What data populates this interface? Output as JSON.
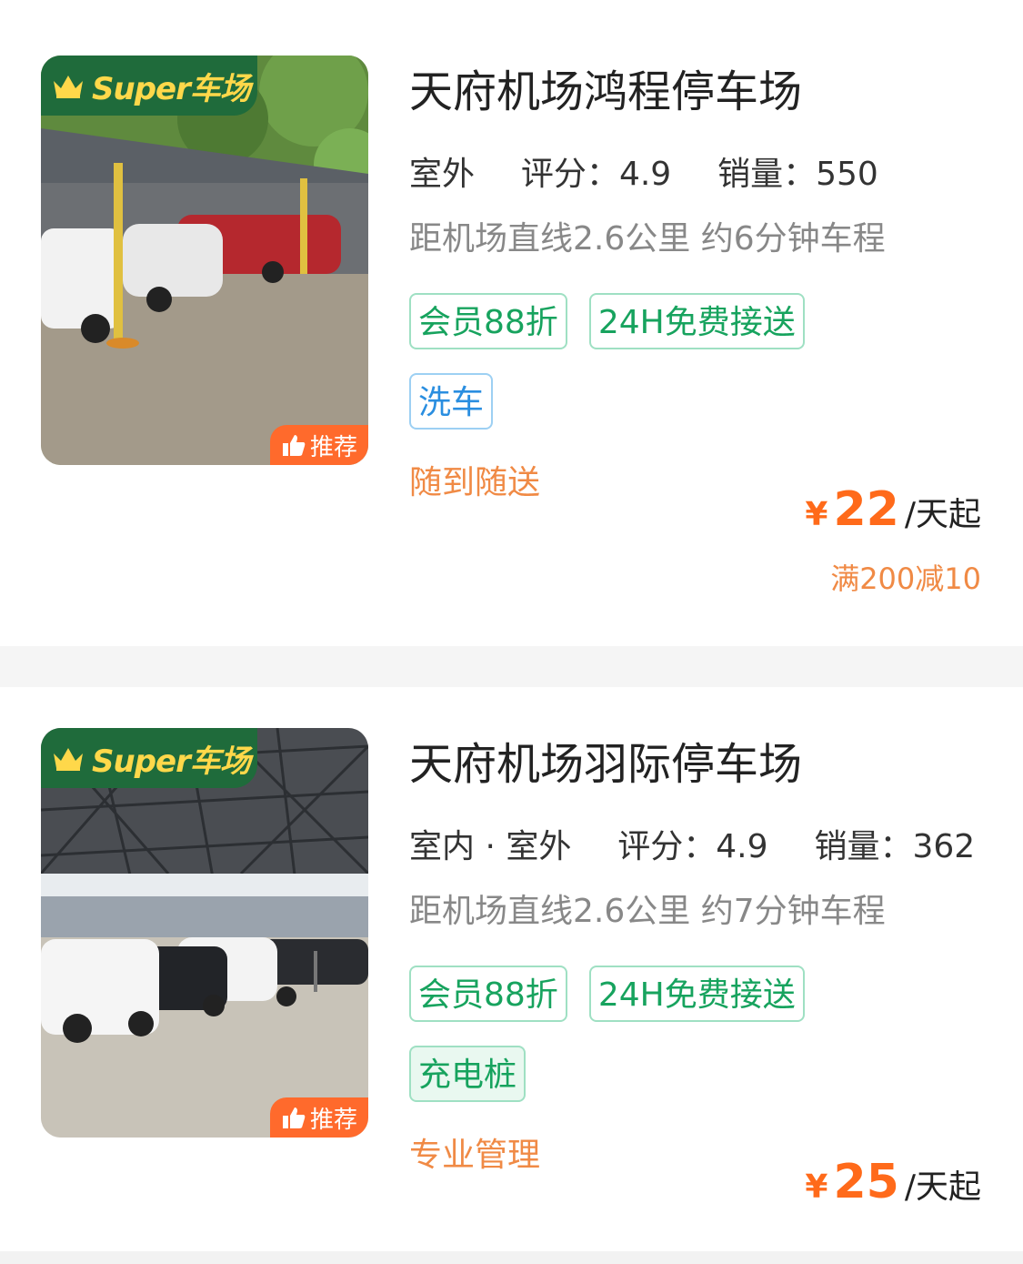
{
  "lots": [
    {
      "super_label": "Super车场",
      "recommend_label": "推荐",
      "title": "天府机场鸿程停车场",
      "type": "室外",
      "rating_label": "评分：",
      "rating": "4.9",
      "sales_label": "销量：",
      "sales": "550",
      "distance": "距机场直线2.6公里 约6分钟车程",
      "tags": [
        "会员88折",
        "24H免费接送"
      ],
      "tag_extra": "洗车",
      "feature": "随到随送",
      "currency": "¥",
      "price": "22",
      "price_unit": "/天起",
      "promo": "满200减10"
    },
    {
      "super_label": "Super车场",
      "recommend_label": "推荐",
      "title": "天府机场羽际停车场",
      "type": "室内 · 室外",
      "rating_label": "评分：",
      "rating": "4.9",
      "sales_label": "销量：",
      "sales": "362",
      "distance": "距机场直线2.6公里 约7分钟车程",
      "tags": [
        "会员88折",
        "24H免费接送"
      ],
      "tag_extra": "充电桩",
      "feature": "专业管理",
      "currency": "¥",
      "price": "25",
      "price_unit": "/天起"
    }
  ],
  "colors": {
    "accent_orange": "#ff6a1a",
    "tag_green": "#17a35e",
    "tag_blue": "#2a8ee0",
    "badge_green": "#1f6b3b",
    "badge_yellow": "#ffd84a"
  }
}
